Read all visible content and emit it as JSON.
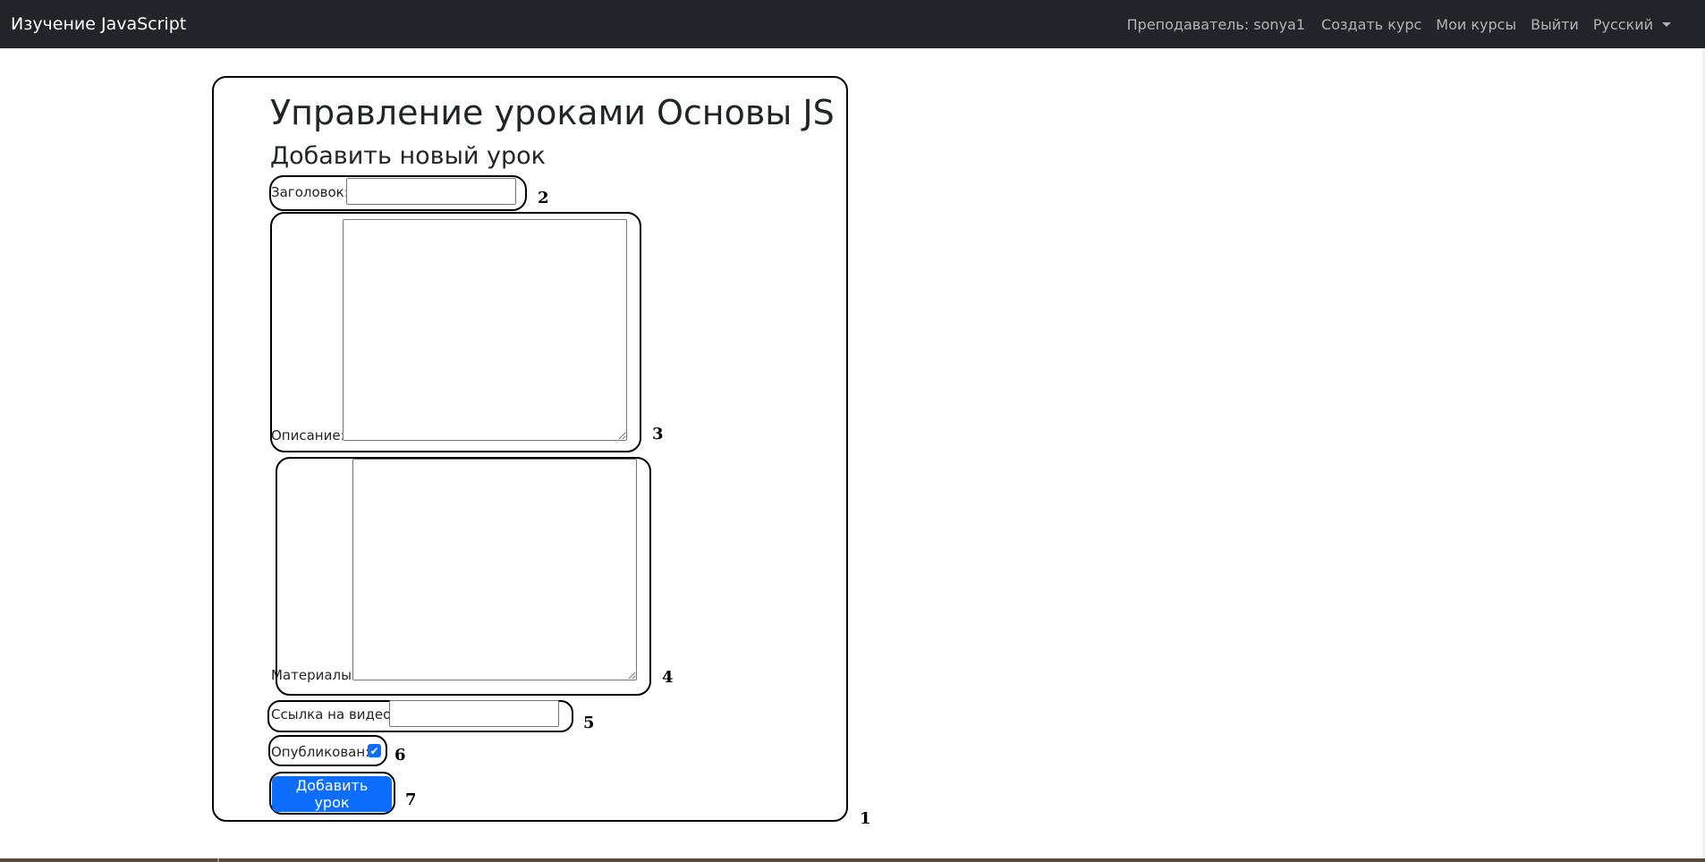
{
  "navbar": {
    "brand": "Изучение JavaScript",
    "teacher": "Преподаватель: sonya1",
    "create_course": "Создать курс",
    "my_courses": "Мои курсы",
    "logout": "Выйти",
    "language": "Русский"
  },
  "page": {
    "title": "Управление уроками Основы JS",
    "subtitle": "Добавить новый урок"
  },
  "form": {
    "title_label": "Заголовок:",
    "title_value": "",
    "description_label": "Описание:",
    "description_value": "",
    "materials_label": "Материалы:",
    "materials_value": "",
    "video_label": "Ссылка на видео:",
    "video_value": "",
    "published_label": "Опубликован:",
    "published_checked": true,
    "submit_label": "Добавить урок"
  },
  "annotations": [
    "1",
    "2",
    "3",
    "4",
    "5",
    "6",
    "7"
  ],
  "colors": {
    "navbar_bg": "#212529",
    "primary": "#0d6efd",
    "nav_text": "rgba(255,255,255,0.65)"
  }
}
